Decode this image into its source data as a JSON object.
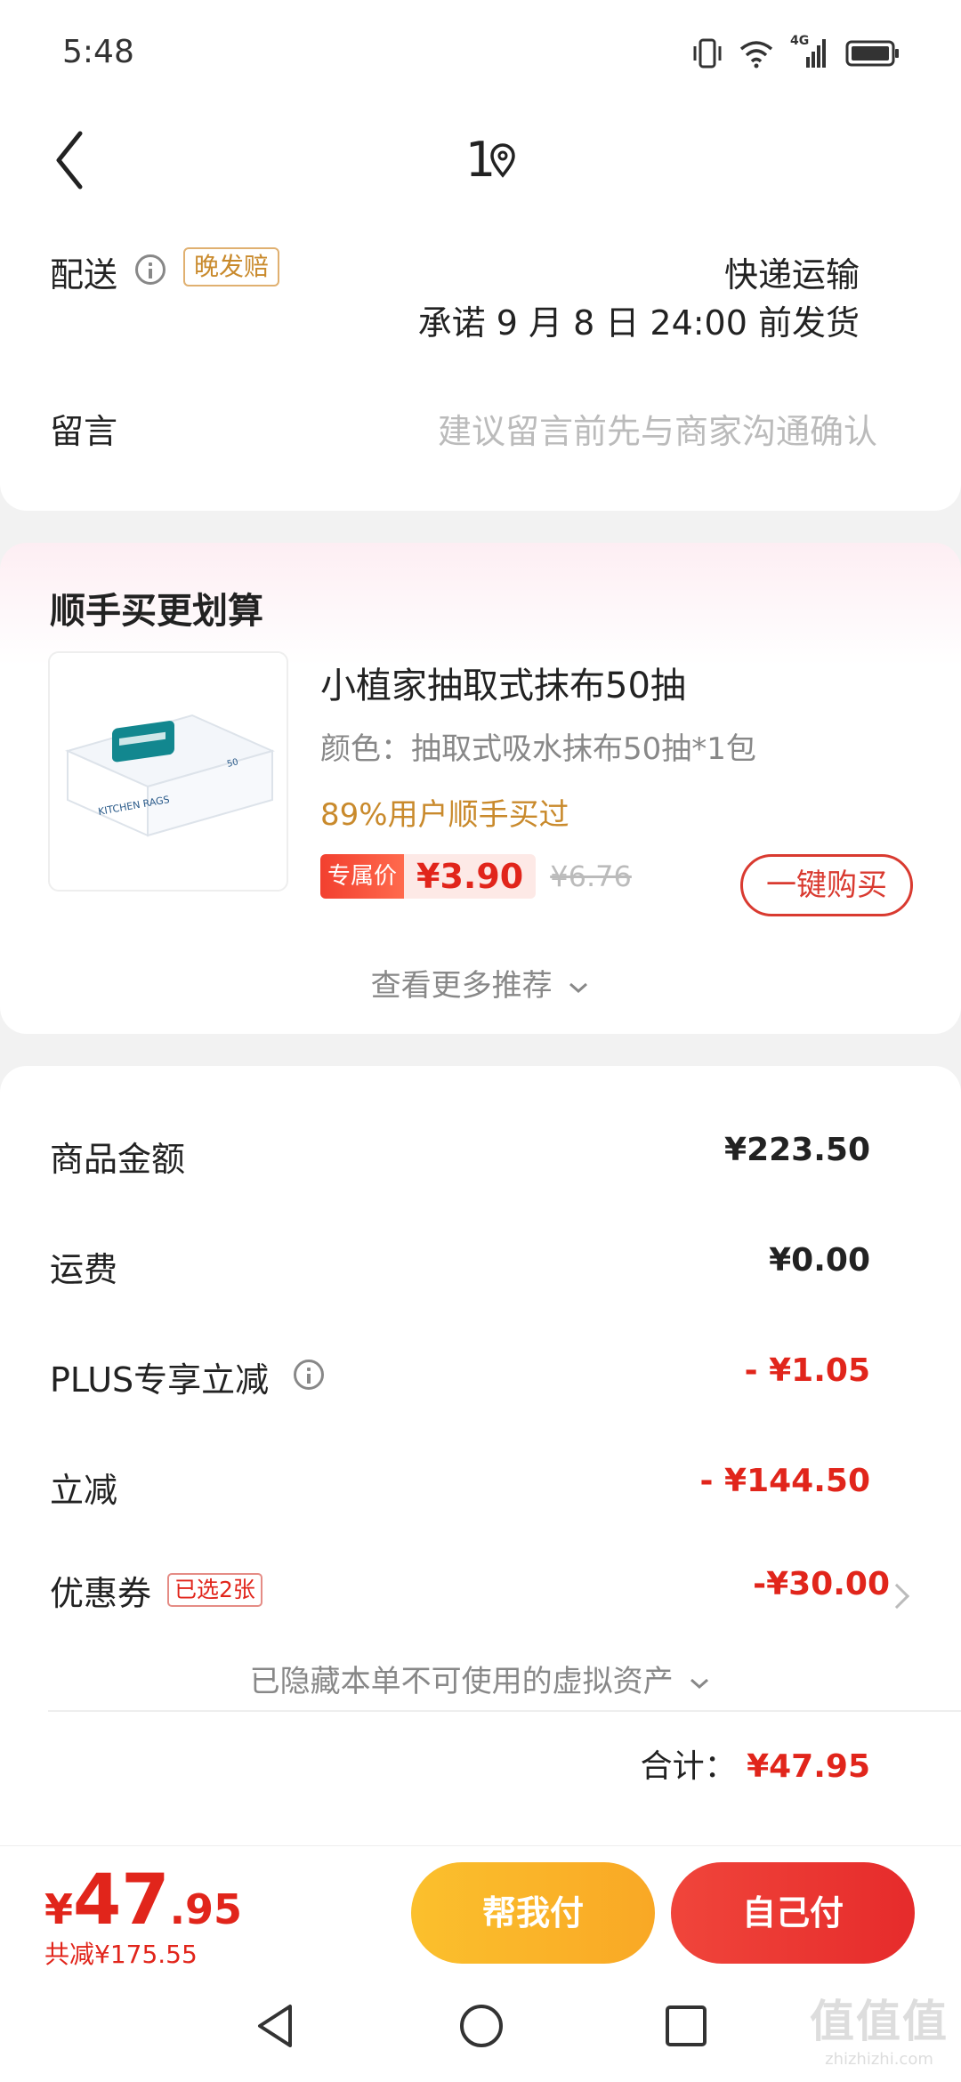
{
  "status": {
    "time": "5:48",
    "network": "4G"
  },
  "header": {
    "title": "1"
  },
  "delivery": {
    "label": "配送",
    "tag": "晚发赔",
    "method": "快递运输",
    "promise": "承诺 9 月 8 日 24:00 前发货"
  },
  "message": {
    "label": "留言",
    "placeholder": "建议留言前先与商家沟通确认"
  },
  "recommend": {
    "title": "顺手买更划算",
    "product_name": "小植家抽取式抹布50抽",
    "spec": "颜色：抽取式吸水抹布50抽*1包",
    "social": "89%用户顺手买过",
    "price_tag": "专属价",
    "price": "¥3.90",
    "original_price": "¥6.76",
    "buy_label": "一键购买",
    "see_more": "查看更多推荐",
    "image_caption": "KITCHEN RAGS",
    "image_count": "50"
  },
  "amounts": {
    "goods_label": "商品金额",
    "goods_value": "¥223.50",
    "shipping_label": "运费",
    "shipping_value": "¥0.00",
    "plus_label": "PLUS专享立减",
    "plus_value": "- ¥1.05",
    "discount_label": "立减",
    "discount_value": "- ¥144.50",
    "coupon_label": "优惠券",
    "coupon_tag": "已选2张",
    "coupon_value": "-¥30.00",
    "hidden_assets": "已隐藏本单不可使用的虚拟资产",
    "total_label": "合计：",
    "total_value": "¥47.95"
  },
  "bottom": {
    "yen": "¥",
    "price_int": "47",
    "price_dec": ".95",
    "saved": "共减¥175.55",
    "help_pay": "帮我付",
    "self_pay": "自己付"
  },
  "watermark": {
    "main": "值值值",
    "sub": "zhizhizhi.com"
  },
  "colors": {
    "accent_red": "#e1251b",
    "gold": "#c98a2c",
    "help_pay_yellow": "#fbc02d"
  }
}
